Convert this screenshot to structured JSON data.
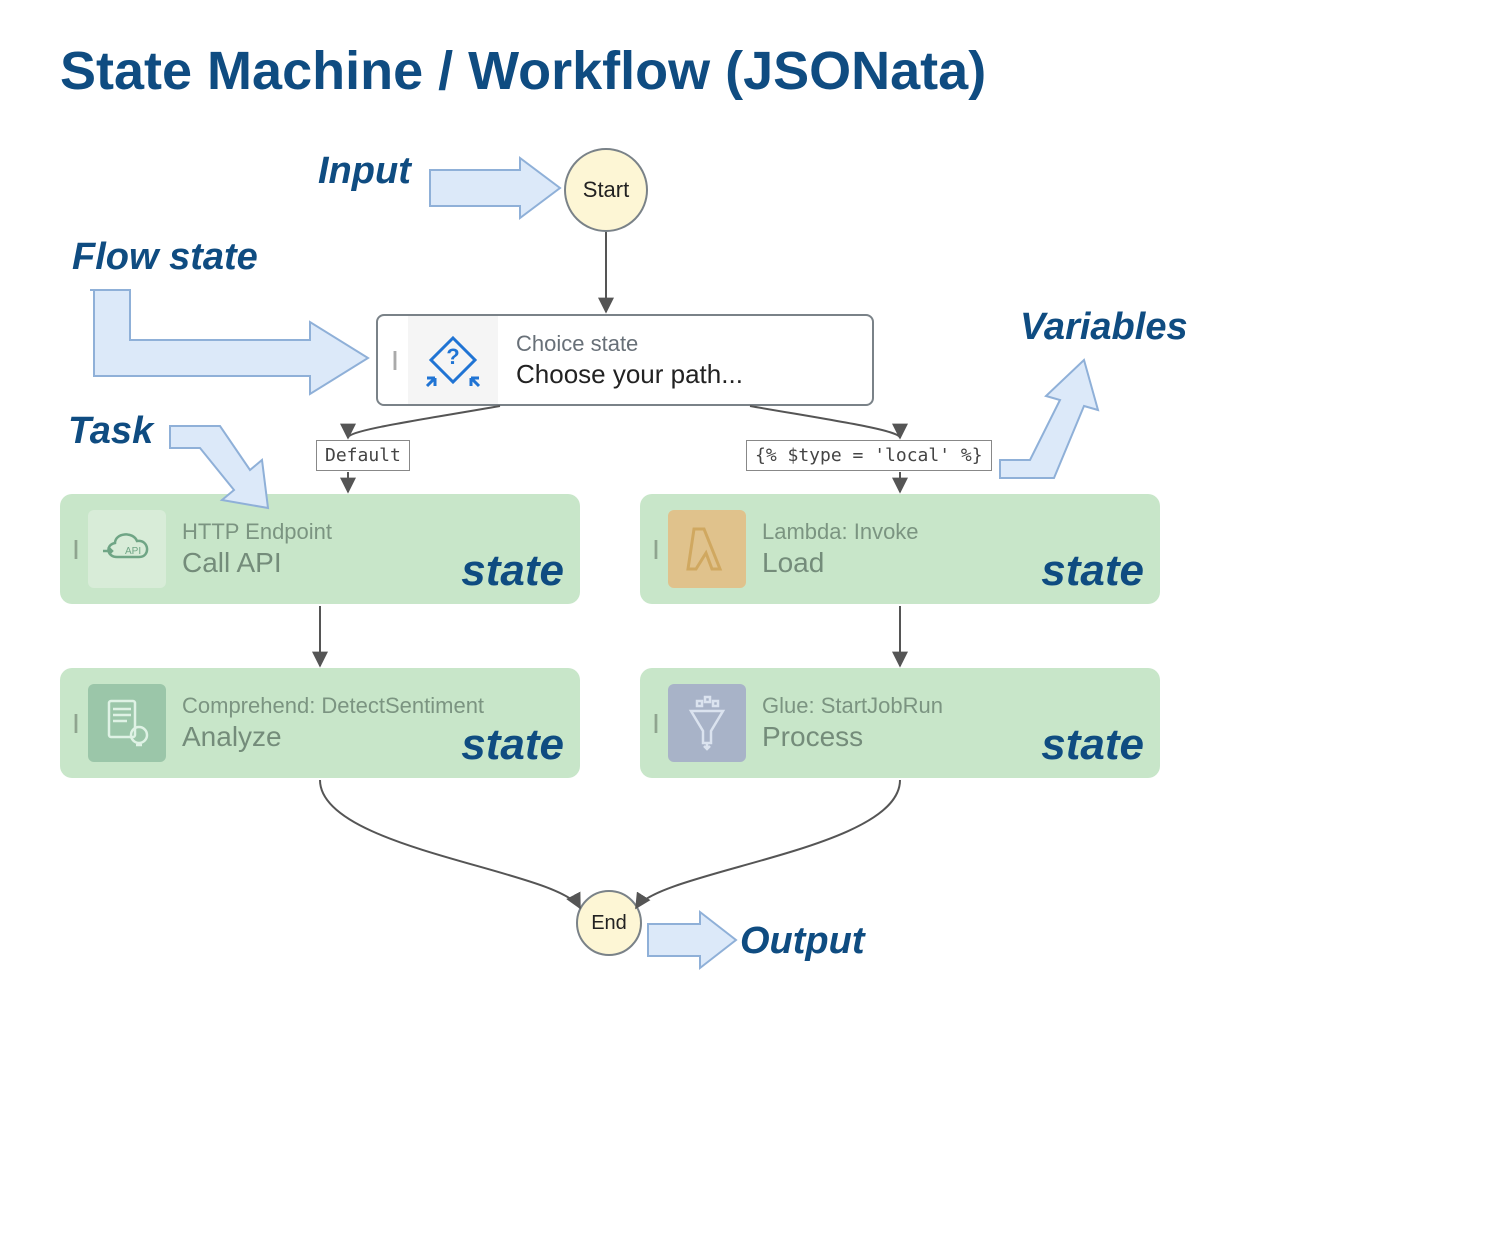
{
  "title": "State Machine / Workflow (JSONata)",
  "labels": {
    "input": "Input",
    "flow_state": "Flow state",
    "task": "Task",
    "variables": "Variables",
    "output": "Output"
  },
  "nodes": {
    "start": "Start",
    "end": "End",
    "choice": {
      "type": "Choice state",
      "name": "Choose your path..."
    }
  },
  "branch_labels": {
    "default": "Default",
    "local": "{% $type = 'local' %}"
  },
  "states": [
    {
      "id": "http",
      "type": "HTTP Endpoint",
      "name": "Call API",
      "tag": "state",
      "icon": "api",
      "icon_bg": "#d8ecd8"
    },
    {
      "id": "lambda",
      "type": "Lambda: Invoke",
      "name": "Load",
      "tag": "state",
      "icon": "lambda",
      "icon_bg": "#e0c28c"
    },
    {
      "id": "comprehend",
      "type": "Comprehend: DetectSentiment",
      "name": "Analyze",
      "tag": "state",
      "icon": "doc",
      "icon_bg": "#9bc6a9"
    },
    {
      "id": "glue",
      "type": "Glue: StartJobRun",
      "name": "Process",
      "tag": "state",
      "icon": "funnel",
      "icon_bg": "#a8b3c8"
    }
  ],
  "colors": {
    "brand": "#0f4c81",
    "arrow_fill": "#dce9f9",
    "arrow_stroke": "#8fb0d8",
    "node_border": "#7a8288",
    "start_bg": "#fdf6d5",
    "state_bg": "#c8e6c9"
  }
}
